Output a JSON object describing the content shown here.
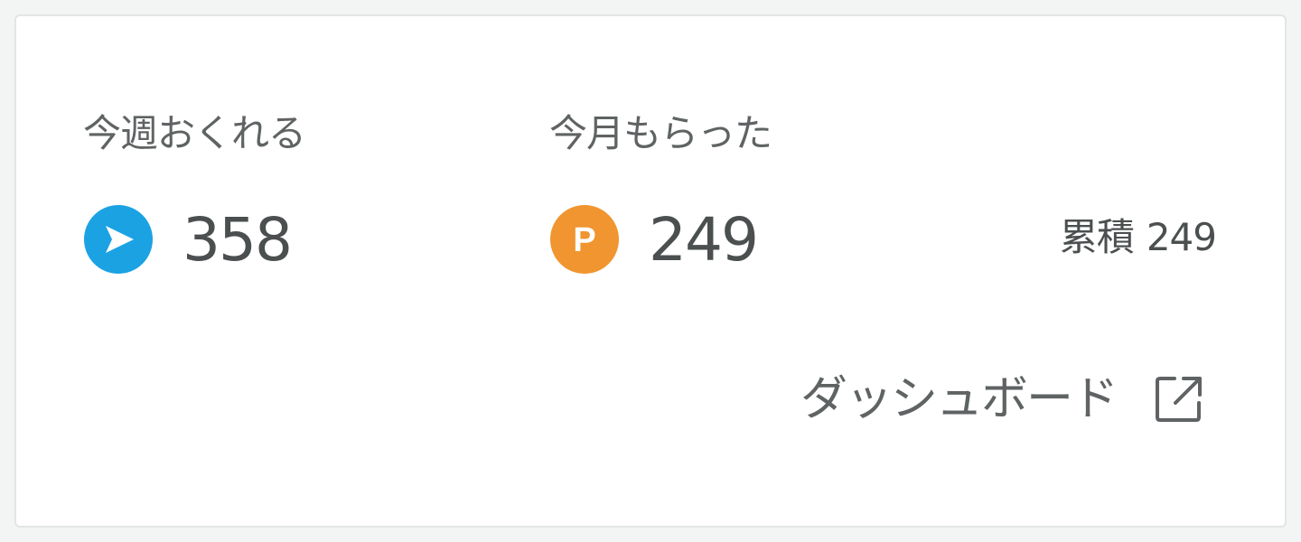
{
  "stats": {
    "send": {
      "label": "今週おくれる",
      "value": "358",
      "icon": "send-arrow-icon",
      "color": "#1ba2e3"
    },
    "receive": {
      "label": "今月もらった",
      "value": "249",
      "icon": "point-p-icon",
      "icon_letter": "P",
      "color": "#f0952f"
    },
    "cumulative": {
      "label": "累積",
      "value": "249"
    }
  },
  "dashboard": {
    "label": "ダッシュボード",
    "icon": "external-link-icon"
  }
}
